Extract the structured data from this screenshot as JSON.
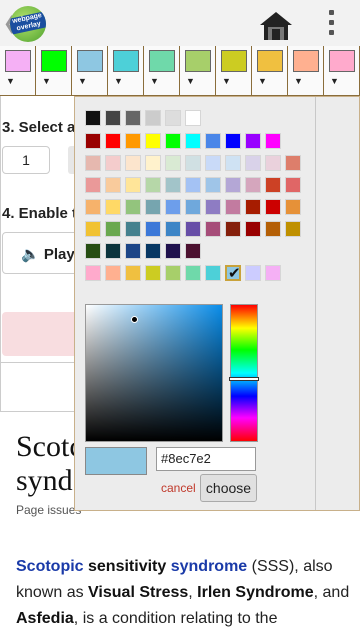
{
  "header": {
    "logo_text_line1": "webpage",
    "logo_text_line2": "overlay",
    "home_icon": "home-icon",
    "menu_icon": "vertical-dots-icon"
  },
  "swatch_strip": [
    {
      "color": "#f5b0f5"
    },
    {
      "color": "#00ff00"
    },
    {
      "color": "#8ec7e2"
    },
    {
      "color": "#4dd0d8"
    },
    {
      "color": "#6fd9aa"
    },
    {
      "color": "#a7cf6a"
    },
    {
      "color": "#cccc22"
    },
    {
      "color": "#f0c040"
    },
    {
      "color": "#ffb090"
    },
    {
      "color": "#ffaacc"
    }
  ],
  "content": {
    "section3": "3. Select a",
    "number_value": "1",
    "section4": "4. Enable t",
    "play_label": "Play",
    "heading_line1": "Scotc",
    "heading_line2": "synd",
    "page_issues": "Page issues"
  },
  "article": {
    "link1": "Scotopic",
    "t1": " sensitivity ",
    "link2": "syndrome",
    "t2": " (SSS), also known as ",
    "b1": "Visual Stress",
    "t3": ", ",
    "b2": "Irlen Syndrome",
    "t4": ", and ",
    "b3": "Asfedia",
    "t5": ", is a condition relating to the"
  },
  "picker": {
    "palette_rows": [
      [
        "#111111",
        "#444444",
        "#666666",
        "#cccccc",
        "#dddddd",
        "#ffffff"
      ],
      [
        "#990000",
        "#ff0000",
        "#ff9900",
        "#ffff00",
        "#00ff00",
        "#00ffff",
        "#4a86e8",
        "#0000ff",
        "#9900ff",
        "#ff00ff"
      ],
      [
        "#e6b8af",
        "#f4cccc",
        "#fce5cd",
        "#fff2cc",
        "#d9ead3",
        "#d0e0e3",
        "#c9daf8",
        "#cfe2f3",
        "#d9d2e9",
        "#ead1dc",
        "#dd7e6b"
      ],
      [
        "#ea9999",
        "#f9cb9c",
        "#ffe599",
        "#b6d7a8",
        "#a2c4c9",
        "#a4c2f4",
        "#9fc5e8",
        "#b4a7d6",
        "#d5a6bd",
        "#cc4125",
        "#e06666"
      ],
      [
        "#f6b26b",
        "#ffd966",
        "#93c47d",
        "#76a5af",
        "#6d9eeb",
        "#6fa8dc",
        "#8e7cc3",
        "#c27ba0",
        "#a61c00",
        "#cc0000",
        "#e69138"
      ],
      [
        "#f1c232",
        "#6aa84f",
        "#45818e",
        "#3c78d8",
        "#3d85c6",
        "#674ea7",
        "#a64d79",
        "#85200c",
        "#990000",
        "#b45f06",
        "#bf9000"
      ],
      [
        "#274e13",
        "#0c343d",
        "#1c4587",
        "#073763",
        "#20124d",
        "#4c1130"
      ],
      [
        "#ffaacc",
        "#ffb090",
        "#f0c040",
        "#cccc22",
        "#a7cf6a",
        "#6fd9aa",
        "#4dd0d8",
        "#8ec7e2",
        "#ccccff",
        "#f5b0f5"
      ]
    ],
    "selected_color": "#8ec7e2",
    "hex_value": "#8ec7e2",
    "cancel_label": "cancel",
    "choose_label": "choose"
  }
}
